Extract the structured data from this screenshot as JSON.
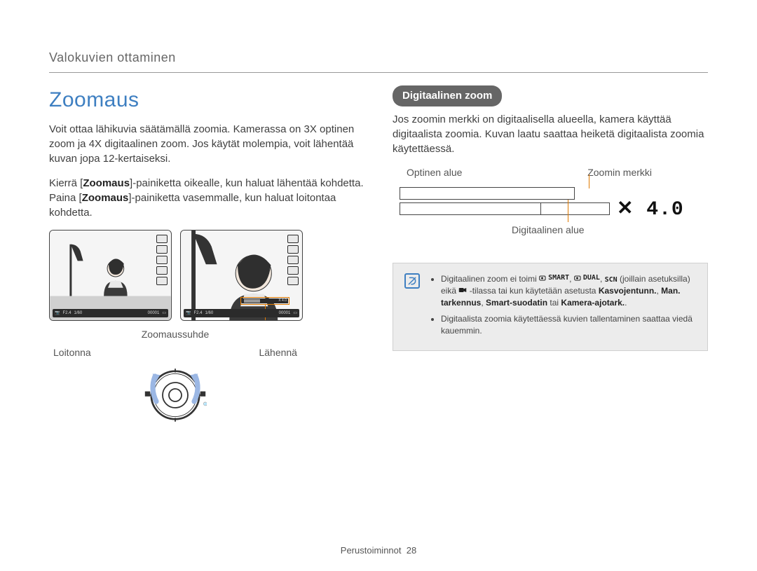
{
  "header": {
    "section": "Valokuvien ottaminen"
  },
  "left": {
    "title": "Zoomaus",
    "p1": "Voit ottaa lähikuvia säätämällä zoomia. Kamerassa on 3X optinen zoom ja 4X digitaalinen zoom. Jos käytät molempia, voit lähentää kuvan jopa 12-kertaiseksi.",
    "p2_pre": "Kierrä [",
    "p2_b1": "Zoomaus",
    "p2_mid": "]-painiketta oikealle, kun haluat lähentää kohdetta. Paina [",
    "p2_b2": "Zoomaus",
    "p2_post": "]-painiketta vasemmalle, kun haluat loitontaa kohdetta.",
    "preview_status": {
      "f": "F2.4",
      "shutter": "1/60",
      "counter": "00001",
      "zoom_overlay": "X 4.0"
    },
    "ratio_label": "Zoomaussuhde",
    "dial_left": "Loitonna",
    "dial_right": "Lähennä"
  },
  "right": {
    "pill": "Digitaalinen zoom",
    "p1": "Jos zoomin merkki on digitaalisella alueella, kamera käyttää digitaalista zoomia. Kuvan laatu saattaa heiketä digitaalista zoomia käytettäessä.",
    "scale_optical": "Optinen alue",
    "scale_marker": "Zoomin merkki",
    "scale_digital": "Digitaalinen alue",
    "scale_value": "4.0",
    "note": {
      "li1_pre": "Digitaalinen zoom ei toimi ",
      "li1_mode_smart": "SMART",
      "li1_mode_dual": "DUAL",
      "li1_mode_scn": "SCN",
      "li1_mid1": " (joillain asetuksilla) eikä ",
      "li1_mid2": " -tilassa tai kun käytetään asetusta ",
      "li1_b1": "Kasvojentunn.",
      "li1_b2": "Man. tarkennus",
      "li1_b3": "Smart-suodatin",
      "li1_or": " tai ",
      "li1_b4": "Kamera-ajotark.",
      "li1_end": ".",
      "li2": "Digitaalista zoomia käytettäessä kuvien tallentaminen saattaa viedä kauemmin."
    }
  },
  "footer": {
    "chapter": "Perustoiminnot",
    "page": "28"
  }
}
